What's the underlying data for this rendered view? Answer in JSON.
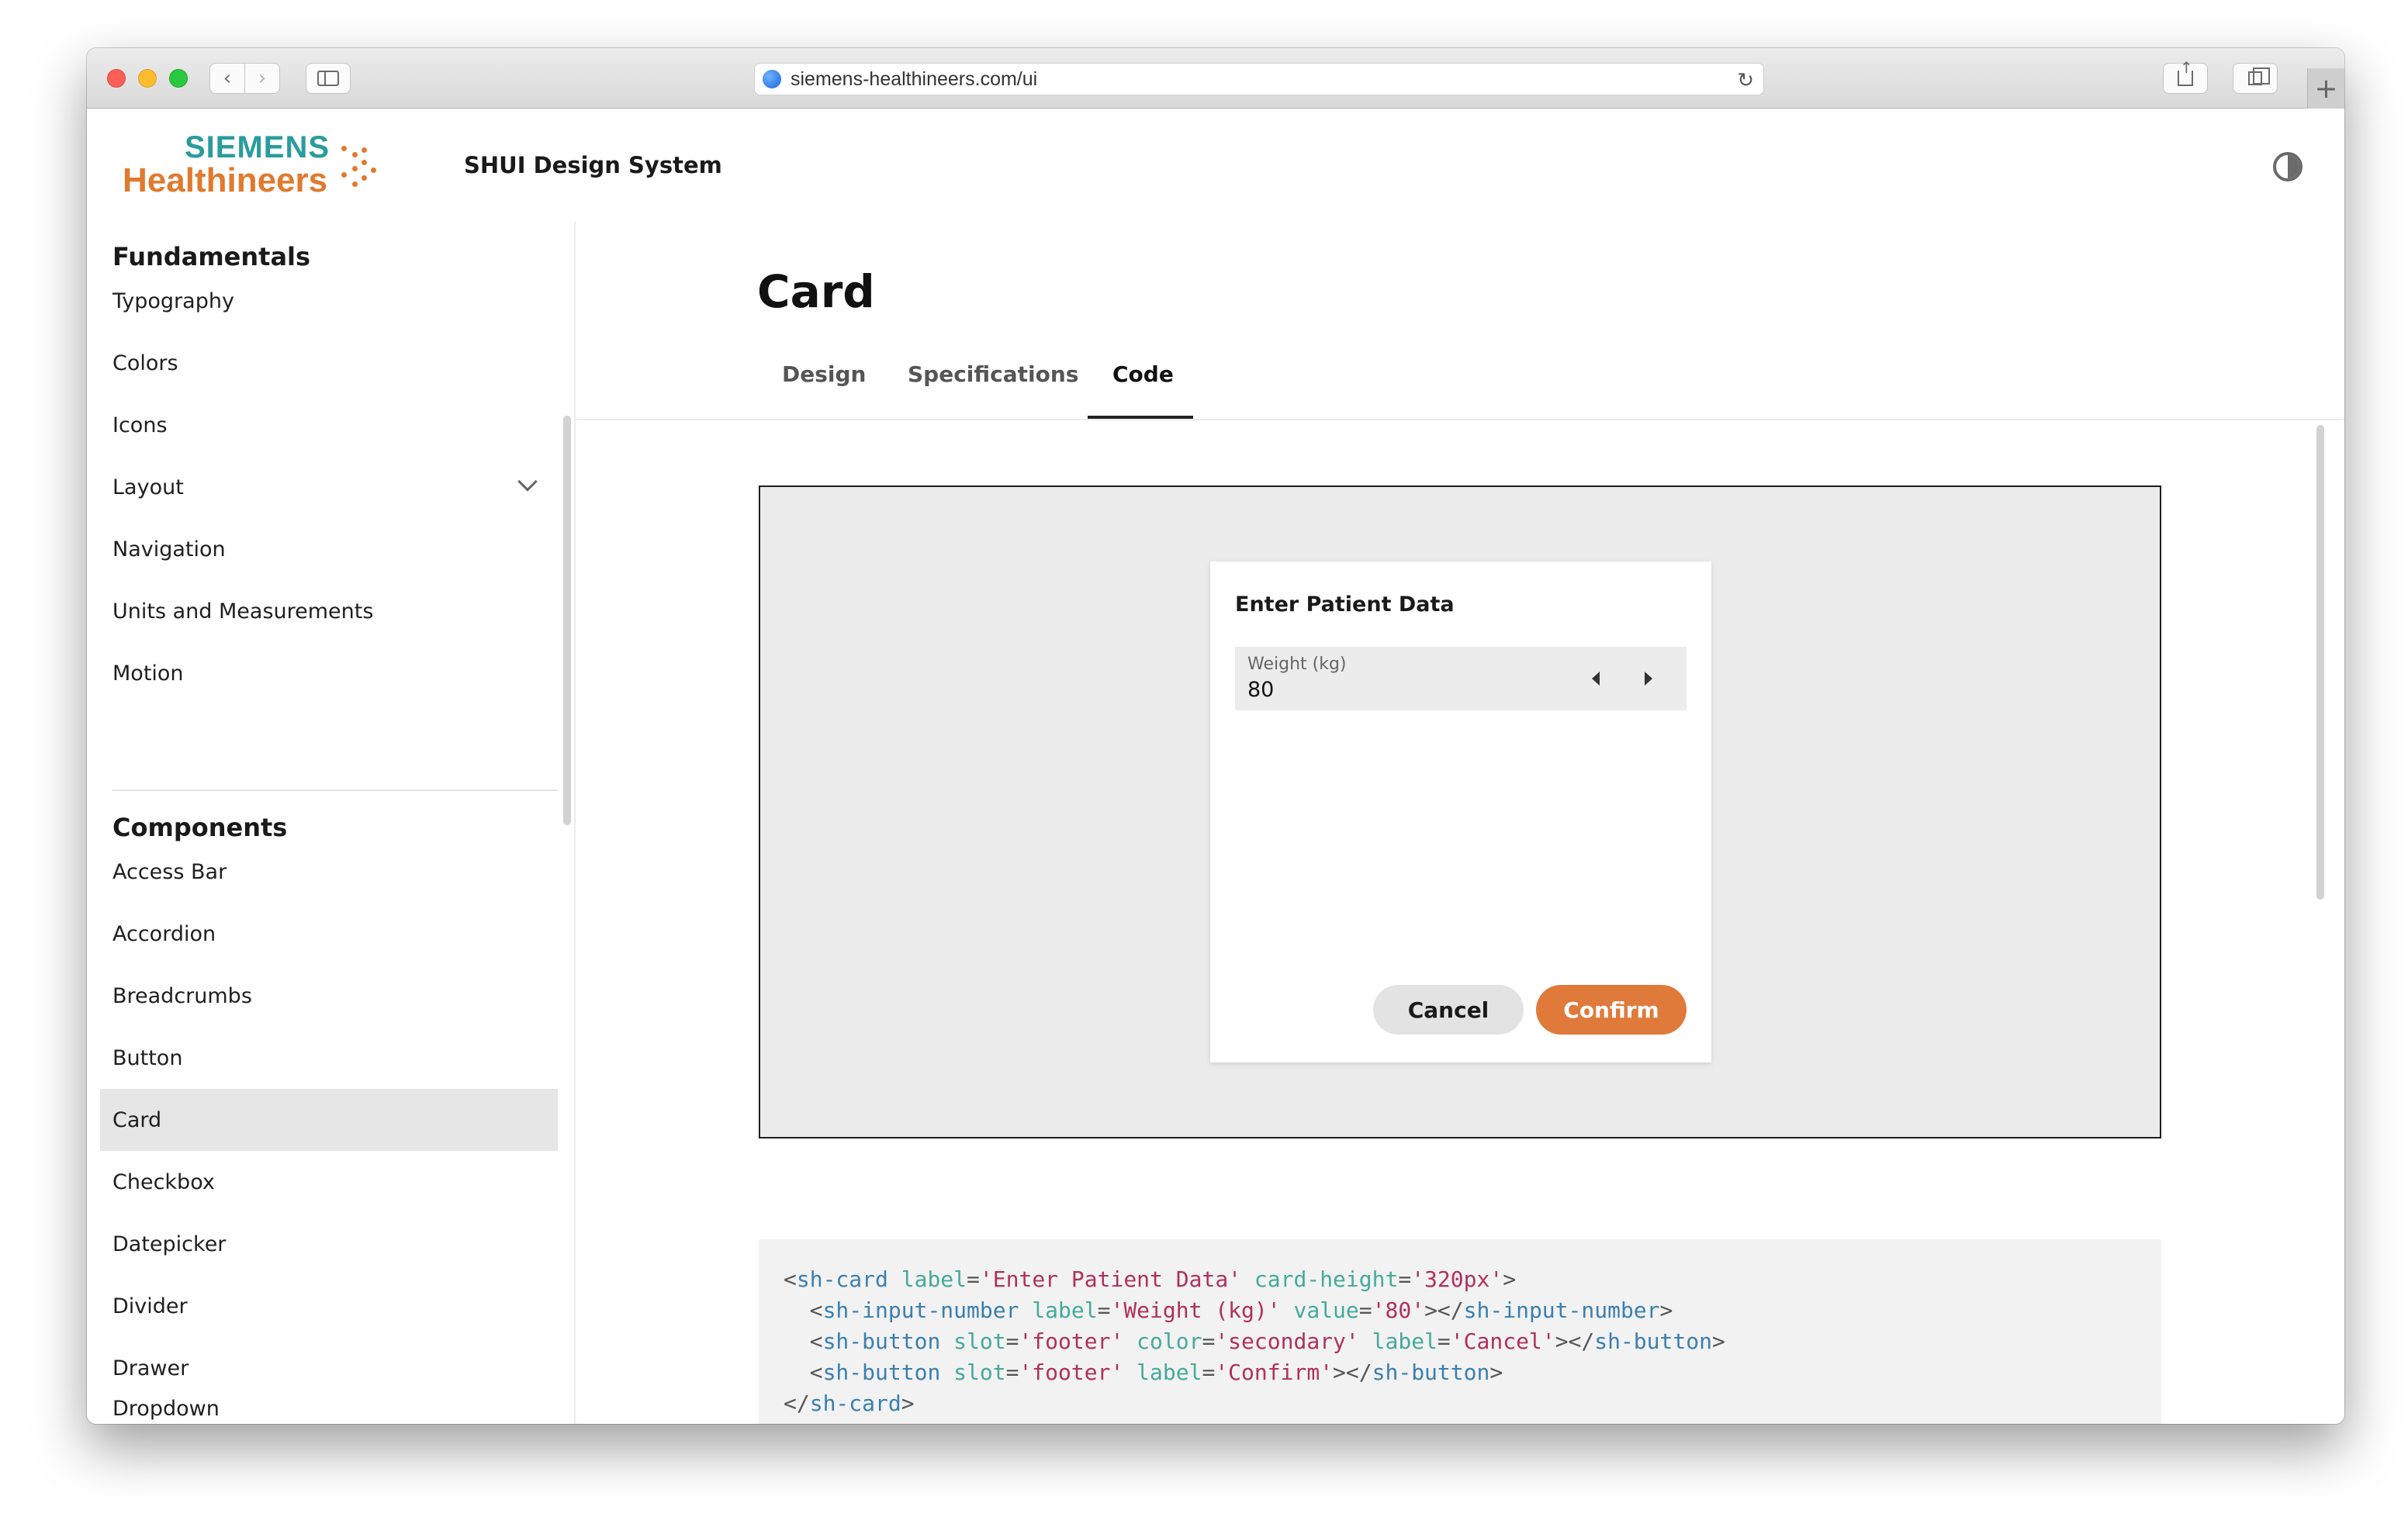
{
  "browser": {
    "url": "siemens-healthineers.com/ui"
  },
  "header": {
    "logo_top": "SIEMENS",
    "logo_bottom": "Healthineers",
    "app_title": "SHUI Design System"
  },
  "sidebar": {
    "fundamentals_heading": "Fundamentals",
    "fundamentals": [
      {
        "label": "Typography"
      },
      {
        "label": "Colors"
      },
      {
        "label": "Icons"
      },
      {
        "label": "Layout"
      },
      {
        "label": "Navigation"
      },
      {
        "label": "Units and Measurements"
      },
      {
        "label": "Motion"
      }
    ],
    "components_heading": "Components",
    "components": [
      {
        "label": "Access Bar"
      },
      {
        "label": "Accordion"
      },
      {
        "label": "Breadcrumbs"
      },
      {
        "label": "Button"
      },
      {
        "label": "Card"
      },
      {
        "label": "Checkbox"
      },
      {
        "label": "Datepicker"
      },
      {
        "label": "Divider"
      },
      {
        "label": "Drawer"
      },
      {
        "label": "Dropdown"
      }
    ],
    "active_item": "Card"
  },
  "main": {
    "title": "Card",
    "tabs": [
      {
        "label": "Design"
      },
      {
        "label": "Specifications"
      },
      {
        "label": "Code"
      }
    ],
    "active_tab": "Code",
    "preview": {
      "card_title": "Enter Patient Data",
      "input_label": "Weight (kg)",
      "input_value": "80",
      "cancel_label": "Cancel",
      "confirm_label": "Confirm"
    },
    "code": {
      "l1_open": "<",
      "l1_tag": "sh-card",
      "l1_a1": "label",
      "l1_v1": "'Enter Patient Data'",
      "l1_a2": "card-height",
      "l1_v2": "'320px'",
      "l1_close": ">",
      "l2_tag": "sh-input-number",
      "l2_a1": "label",
      "l2_v1": "'Weight (kg)'",
      "l2_a2": "value",
      "l2_v2": "'80'",
      "l2_end": "></",
      "l2_tag2": "sh-input-number",
      "l3_tag": "sh-button",
      "l3_a1": "slot",
      "l3_v1": "'footer'",
      "l3_a2": "color",
      "l3_v2": "'secondary'",
      "l3_a3": "label",
      "l3_v3": "'Cancel'",
      "l4_a1": "slot",
      "l4_v1": "'footer'",
      "l4_a2": "label",
      "l4_v2": "'Confirm'",
      "l5_open": "</",
      "eq": "="
    }
  },
  "colors": {
    "brand_teal": "#2a9c9c",
    "brand_orange": "#e07a2e",
    "confirm_button": "#e07a3b",
    "active_nav_bg": "#e6e6e6"
  },
  "icons": [
    "globe-icon",
    "reload-icon",
    "chevron-down-icon",
    "contrast-icon",
    "stepper-left-icon",
    "stepper-right-icon"
  ]
}
